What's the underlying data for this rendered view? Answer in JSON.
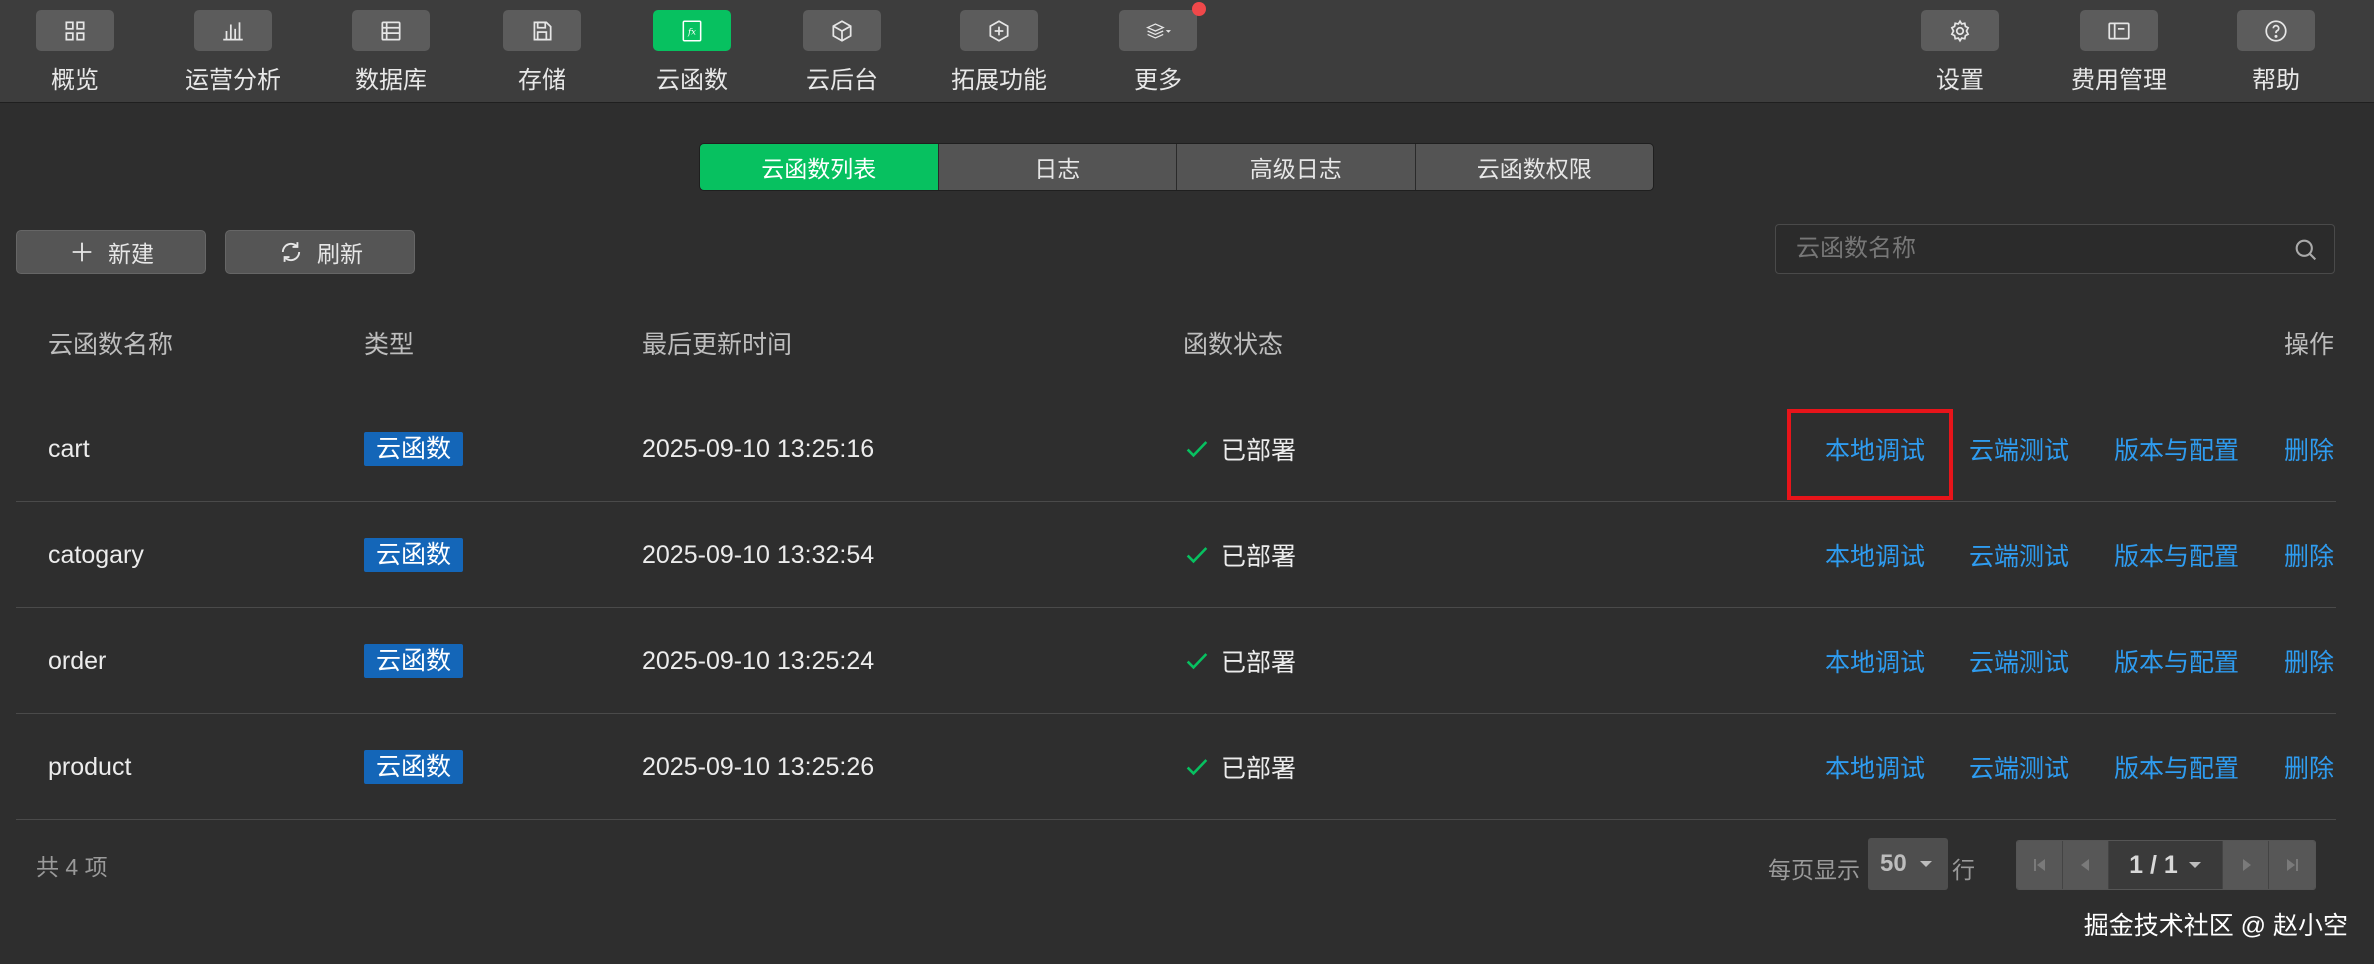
{
  "toolbar": {
    "items": [
      {
        "label": "概览",
        "icon": "grid-icon"
      },
      {
        "label": "运营分析",
        "icon": "bar-chart-icon"
      },
      {
        "label": "数据库",
        "icon": "database-icon"
      },
      {
        "label": "存储",
        "icon": "save-icon"
      },
      {
        "label": "云函数",
        "icon": "fx-icon",
        "active": true
      },
      {
        "label": "云后台",
        "icon": "cube-icon"
      },
      {
        "label": "拓展功能",
        "icon": "extension-icon"
      },
      {
        "label": "更多",
        "icon": "layers-icon",
        "has_notification": true
      }
    ],
    "right_items": [
      {
        "label": "设置",
        "icon": "gear-icon"
      },
      {
        "label": "费用管理",
        "icon": "billing-icon"
      },
      {
        "label": "帮助",
        "icon": "help-icon"
      }
    ],
    "fx_glyph": "fx"
  },
  "tabs": [
    {
      "label": "云函数列表",
      "active": true
    },
    {
      "label": "日志"
    },
    {
      "label": "高级日志"
    },
    {
      "label": "云函数权限"
    }
  ],
  "actions": {
    "new_label": "新建",
    "refresh_label": "刷新"
  },
  "search": {
    "placeholder": "云函数名称"
  },
  "table": {
    "headers": {
      "name": "云函数名称",
      "type": "类型",
      "updated": "最后更新时间",
      "status": "函数状态",
      "ops": "操作"
    },
    "rows": [
      {
        "name": "cart",
        "type": "云函数",
        "updated": "2025-09-10 13:25:16",
        "status": "已部署"
      },
      {
        "name": "catogary",
        "type": "云函数",
        "updated": "2025-09-10 13:32:54",
        "status": "已部署"
      },
      {
        "name": "order",
        "type": "云函数",
        "updated": "2025-09-10 13:25:24",
        "status": "已部署"
      },
      {
        "name": "product",
        "type": "云函数",
        "updated": "2025-09-10 13:25:26",
        "status": "已部署"
      }
    ],
    "row_actions": {
      "local_debug": "本地调试",
      "cloud_test": "云端测试",
      "version_config": "版本与配置",
      "delete": "删除"
    }
  },
  "footer": {
    "total": "共 4 项",
    "page_size_label": "每页显示",
    "page_size": "50",
    "rows_unit": "行",
    "page_indicator": "1 / 1"
  },
  "watermark": "掘金技术社区 @ 赵小空",
  "colors": {
    "accent": "#07c160",
    "link": "#2e9cf0",
    "badge": "#1466b8",
    "highlight": "#e8141a",
    "notification": "#f0484a"
  }
}
